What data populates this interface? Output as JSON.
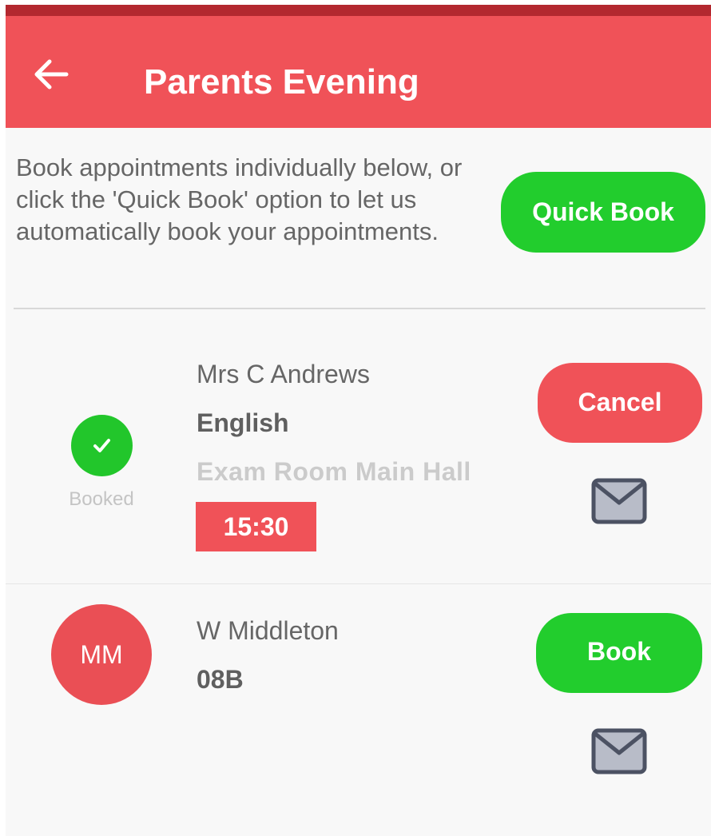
{
  "header": {
    "title": "Parents Evening",
    "back_icon": "arrow-left-icon"
  },
  "intro": {
    "text": "Book appointments individually below, or click the 'Quick Book' option to let us automatically book your appointments.",
    "quick_book_label": "Quick Book"
  },
  "appointments": [
    {
      "status_label": "Booked",
      "status_icon": "check-icon",
      "teacher": "Mrs C Andrews",
      "subject": "English",
      "room": "Exam Room Main Hall",
      "time": "15:30",
      "action_label": "Cancel",
      "message_icon": "envelope-icon"
    },
    {
      "initials": "MM",
      "teacher": "W Middleton",
      "subject": "08B",
      "action_label": "Book",
      "message_icon": "envelope-icon"
    }
  ],
  "colors": {
    "app_bar": "#f05258",
    "status_bar": "#b3282f",
    "green": "#22cd2d",
    "red": "#f05258"
  }
}
